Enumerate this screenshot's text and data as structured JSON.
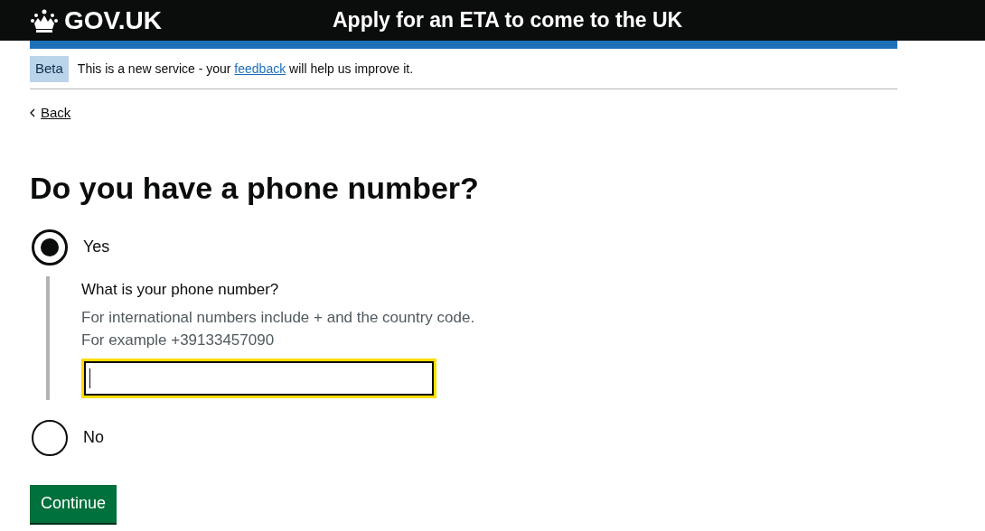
{
  "header": {
    "logo_text": "GOV.UK",
    "service_name": "Apply for an ETA to come to the UK"
  },
  "phase_banner": {
    "tag": "Beta",
    "text_before": "This is a new service - your",
    "link": "feedback",
    "text_after": "will help us improve it."
  },
  "back_link": "Back",
  "question": "Do you have a phone number?",
  "options": [
    {
      "label": "Yes",
      "selected": true,
      "conditional": {
        "label": "What is your phone number?",
        "hint": [
          "For international numbers include + and the country code.",
          "For example +39133457090"
        ],
        "focused": true
      }
    },
    {
      "label": "No",
      "selected": false
    }
  ],
  "button": "Continue"
}
